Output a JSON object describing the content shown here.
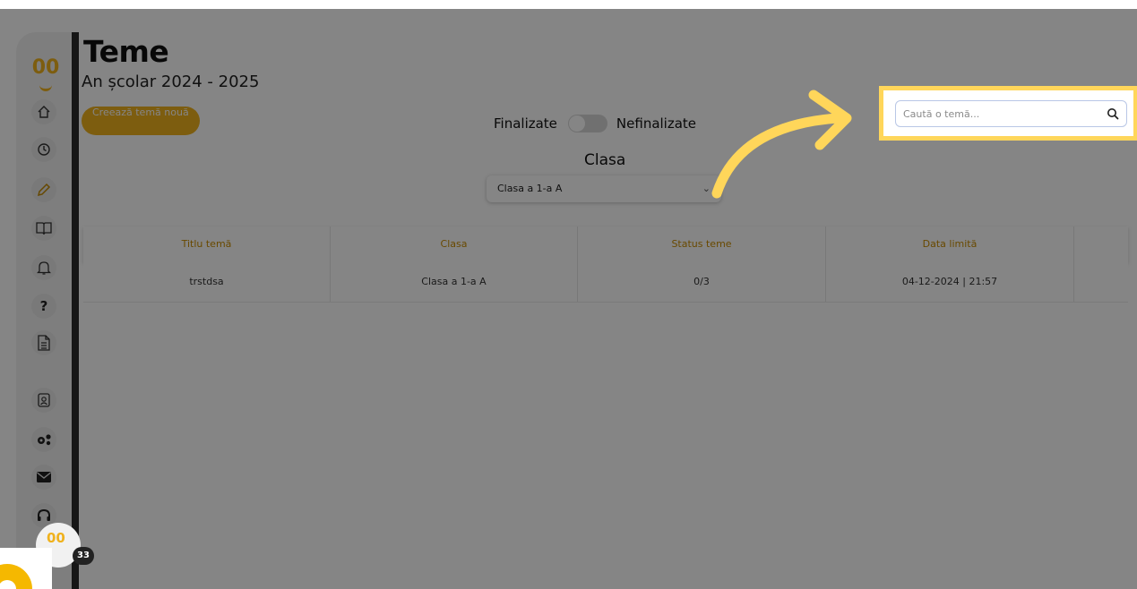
{
  "app": {
    "title": "Teme",
    "subtitle": "An școlar 2024 - 2025",
    "logo_text": "00"
  },
  "sidebar": {
    "items": [
      {
        "icon": "home-icon"
      },
      {
        "icon": "clock-icon"
      },
      {
        "icon": "pencil-icon"
      },
      {
        "icon": "book-icon"
      },
      {
        "icon": "bell-icon"
      },
      {
        "icon": "question-icon",
        "label": "?"
      },
      {
        "icon": "document-icon"
      },
      {
        "icon": "contacts-icon"
      },
      {
        "icon": "gears-icon"
      },
      {
        "icon": "mail-icon"
      },
      {
        "icon": "headphones-icon"
      }
    ]
  },
  "toolbar": {
    "create_label": "Creează temă nouă",
    "toggle_left": "Finalizate",
    "toggle_right": "Nefinalizate",
    "class_label": "Clasa",
    "class_selected": "Clasa a 1-a A",
    "search_placeholder": "Caută o temă..."
  },
  "table": {
    "columns": [
      "Titlu temă",
      "Clasa",
      "Status teme",
      "Data limită",
      ""
    ],
    "rows": [
      [
        "trstdsa",
        "Clasa a 1-a A",
        "0/3",
        "04-12-2024 | 21:57",
        ""
      ]
    ]
  },
  "widget": {
    "logo_text": "00",
    "badge": "33"
  },
  "colors": {
    "accent": "#f0b21d",
    "highlight": "#ffd65a",
    "overlay": "rgba(0,0,0,0.48)",
    "text": "#111111"
  }
}
